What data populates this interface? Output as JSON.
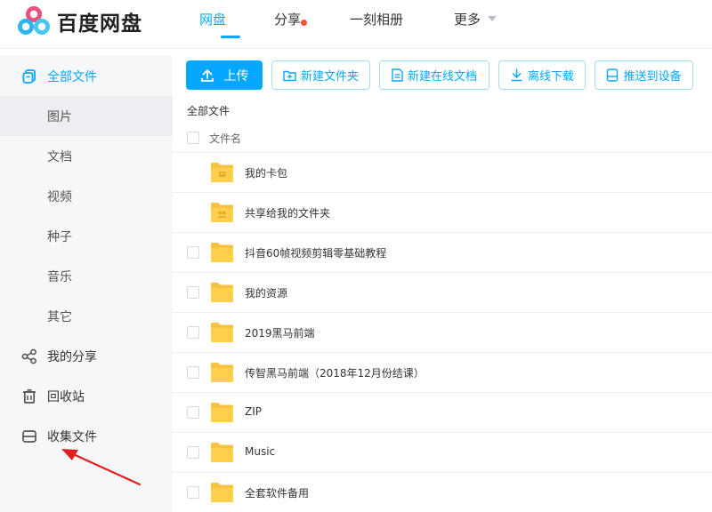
{
  "app": {
    "name": "百度网盘",
    "brand_color": "#06a7ff"
  },
  "nav": {
    "items": [
      {
        "label": "网盘",
        "active": true
      },
      {
        "label": "分享",
        "badge_dot": true
      },
      {
        "label": "一刻相册"
      },
      {
        "label": "更多",
        "dropdown": true
      }
    ]
  },
  "sidebar": {
    "items": [
      {
        "label": "全部文件",
        "icon": "files-icon",
        "selected": true
      },
      {
        "label": "图片",
        "sub": true
      },
      {
        "label": "文档",
        "sub": true
      },
      {
        "label": "视频",
        "sub": true
      },
      {
        "label": "种子",
        "sub": true
      },
      {
        "label": "音乐",
        "sub": true
      },
      {
        "label": "其它",
        "sub": true
      },
      {
        "label": "我的分享",
        "icon": "share-icon"
      },
      {
        "label": "回收站",
        "icon": "trash-icon"
      },
      {
        "label": "收集文件",
        "icon": "collect-icon"
      }
    ]
  },
  "toolbar": {
    "upload": "上传",
    "new_folder": "新建文件夹",
    "new_online_doc": "新建在线文档",
    "offline_download": "离线下载",
    "push_to_device": "推送到设备"
  },
  "breadcrumb": "全部文件",
  "list": {
    "header": "文件名",
    "rows": [
      {
        "name": "我的卡包",
        "type": "card-folder",
        "checkbox": false
      },
      {
        "name": "共享给我的文件夹",
        "type": "shared-folder",
        "checkbox": false
      },
      {
        "name": "抖音60帧视频剪辑零基础教程",
        "type": "folder",
        "checkbox": true
      },
      {
        "name": "我的资源",
        "type": "folder",
        "checkbox": true
      },
      {
        "name": "2019黑马前端",
        "type": "folder",
        "checkbox": true
      },
      {
        "name": "传智黑马前端（2018年12月份结课）",
        "type": "folder",
        "checkbox": true
      },
      {
        "name": "ZIP",
        "type": "folder",
        "checkbox": true
      },
      {
        "name": "Music",
        "type": "folder",
        "checkbox": true
      },
      {
        "name": "全套软件备用",
        "type": "folder",
        "checkbox": true
      }
    ]
  },
  "colors": {
    "folder": "#ffd04b",
    "folder_tab": "#f8c13f",
    "annotation": "#e02020"
  }
}
